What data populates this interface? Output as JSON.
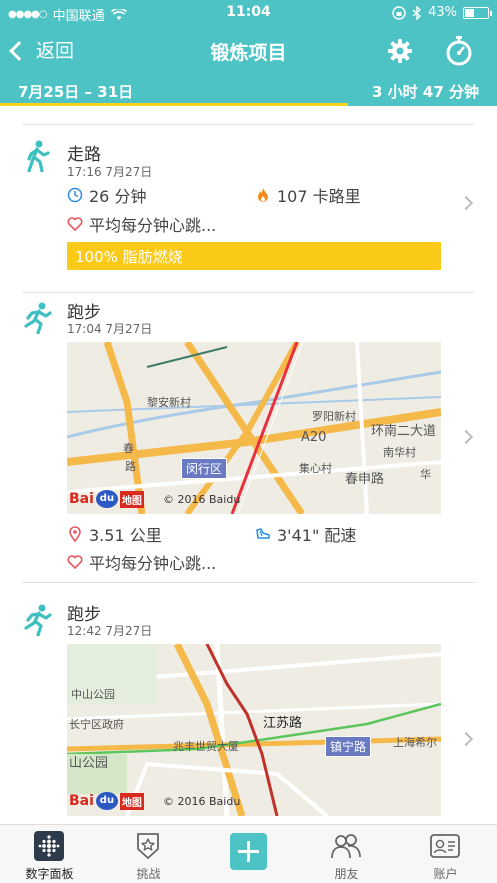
{
  "status_bar": {
    "carrier": "中国联通",
    "time": "11:04",
    "battery": "43%",
    "battery_level": 0.43
  },
  "nav": {
    "back_label": "返回",
    "title": "锻炼项目"
  },
  "week": {
    "range": "7月25日 – 31日",
    "total": "3 小时 47 分钟",
    "progress": 0.7
  },
  "activities": [
    {
      "name": "走路",
      "time": "17:16 7月27日",
      "duration": "26 分钟",
      "calories": "107 卡路里",
      "heart_rate": "平均每分钟心跳...",
      "fat_burn": "100% 脂肪燃烧"
    },
    {
      "name": "跑步",
      "time": "17:04 7月27日",
      "map": {
        "labels": [
          "黎安新村",
          "罗阳新村",
          "A20",
          "环南二大道",
          "集心村",
          "春申路",
          "南华村",
          "华",
          "春",
          "路"
        ],
        "badge": "闵行区",
        "copyright": "© 2016 Baidu"
      },
      "distance": "3.51 公里",
      "pace": "3'41\" 配速",
      "heart_rate": "平均每分钟心跳..."
    },
    {
      "name": "跑步",
      "time": "12:42 7月27日",
      "map": {
        "labels": [
          "中山公园",
          "长宁区政府",
          "江苏路",
          "兆丰世贸大厦",
          "山公园",
          "上海希尔"
        ],
        "badge": "镇宁路",
        "copyright": "© 2016 Baidu"
      }
    }
  ],
  "baidu_logo": {
    "bai": "Bai",
    "du": "du",
    "ditu": "地图"
  },
  "tabs": [
    {
      "label": "数字面板",
      "icon": "dashboard-icon"
    },
    {
      "label": "挑战",
      "icon": "challenge-icon"
    },
    {
      "label": "",
      "icon": "plus-icon"
    },
    {
      "label": "朋友",
      "icon": "friends-icon"
    },
    {
      "label": "账户",
      "icon": "account-icon"
    }
  ],
  "colors": {
    "accent": "#4ec3c6",
    "fat_burn": "#fbc918",
    "route": "#e8313a"
  }
}
